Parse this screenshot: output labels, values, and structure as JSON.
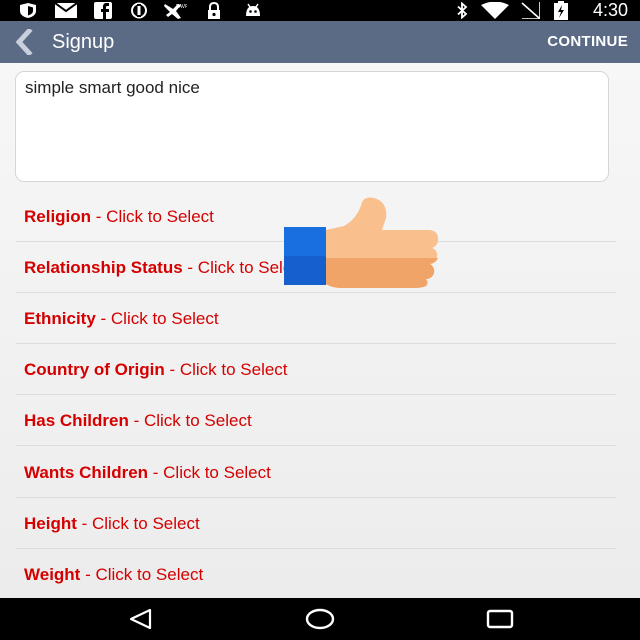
{
  "status_bar": {
    "time": "4:30",
    "left_icons": [
      "shield-icon",
      "mail-icon",
      "facebook-icon",
      "sync-icon",
      "airplane-icon",
      "lock-icon",
      "android-icon"
    ],
    "right_icons": [
      "bluetooth-icon",
      "wifi-icon",
      "no-signal-icon",
      "battery-icon"
    ]
  },
  "action_bar": {
    "title": "Signup",
    "continue_label": "CONTINUE",
    "bg_color": "#5b6b85"
  },
  "bio": {
    "value": "simple smart good nice"
  },
  "fields": [
    {
      "label": "Religion",
      "action": " - Click to Select"
    },
    {
      "label": "Relationship Status",
      "action": " - Click to Select"
    },
    {
      "label": "Ethnicity",
      "action": " - Click to Select"
    },
    {
      "label": "Country of Origin",
      "action": " - Click to Select"
    },
    {
      "label": "Has Children",
      "action": " - Click to Select"
    },
    {
      "label": "Wants Children",
      "action": " - Click to Select"
    },
    {
      "label": "Height",
      "action": " - Click to Select"
    },
    {
      "label": "Weight",
      "action": " - Click to Select"
    }
  ],
  "colors": {
    "field_label": "#d50000",
    "thumb_cuff": "#1a6fe0",
    "thumb_hand": "#f5b07a"
  },
  "nav_bar": {
    "icons": [
      "back-triangle-icon",
      "home-circle-icon",
      "recents-square-icon"
    ]
  }
}
